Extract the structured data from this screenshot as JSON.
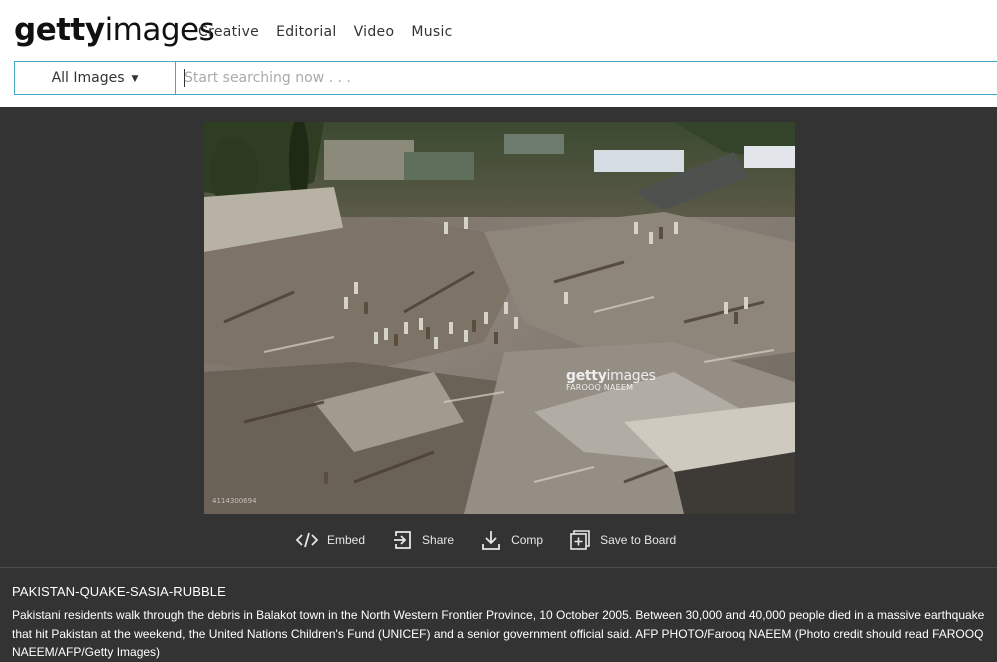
{
  "header": {
    "logo": {
      "bold": "getty",
      "light": "images"
    },
    "nav": [
      "Creative",
      "Editorial",
      "Video",
      "Music"
    ]
  },
  "search": {
    "filter_label": "All Images",
    "placeholder": "Start searching now . . ."
  },
  "photo": {
    "alt": "PAKISTAN-QUAKE-SASIA-RUBBLE",
    "watermark_logo_bold": "getty",
    "watermark_logo_light": "images",
    "watermark_credit": "FAROOQ NAEEM",
    "image_id": "4114300694"
  },
  "actions": [
    {
      "label": "Embed",
      "icon": "embed-icon"
    },
    {
      "label": "Share",
      "icon": "share-icon"
    },
    {
      "label": "Comp",
      "icon": "download-icon"
    },
    {
      "label": "Save to Board",
      "icon": "board-add-icon"
    }
  ],
  "caption": {
    "title": "PAKISTAN-QUAKE-SASIA-RUBBLE",
    "body": "Pakistani residents walk through the debris in Balakot town in the North Western Frontier Province, 10 October 2005. Between 30,000 and 40,000 people died in a massive earthquake that hit Pakistan at the weekend, the United Nations Children's Fund (UNICEF) and a senior government official said. AFP PHOTO/Farooq NAEEM (Photo credit should read FAROOQ NAEEM/AFP/Getty Images)"
  }
}
